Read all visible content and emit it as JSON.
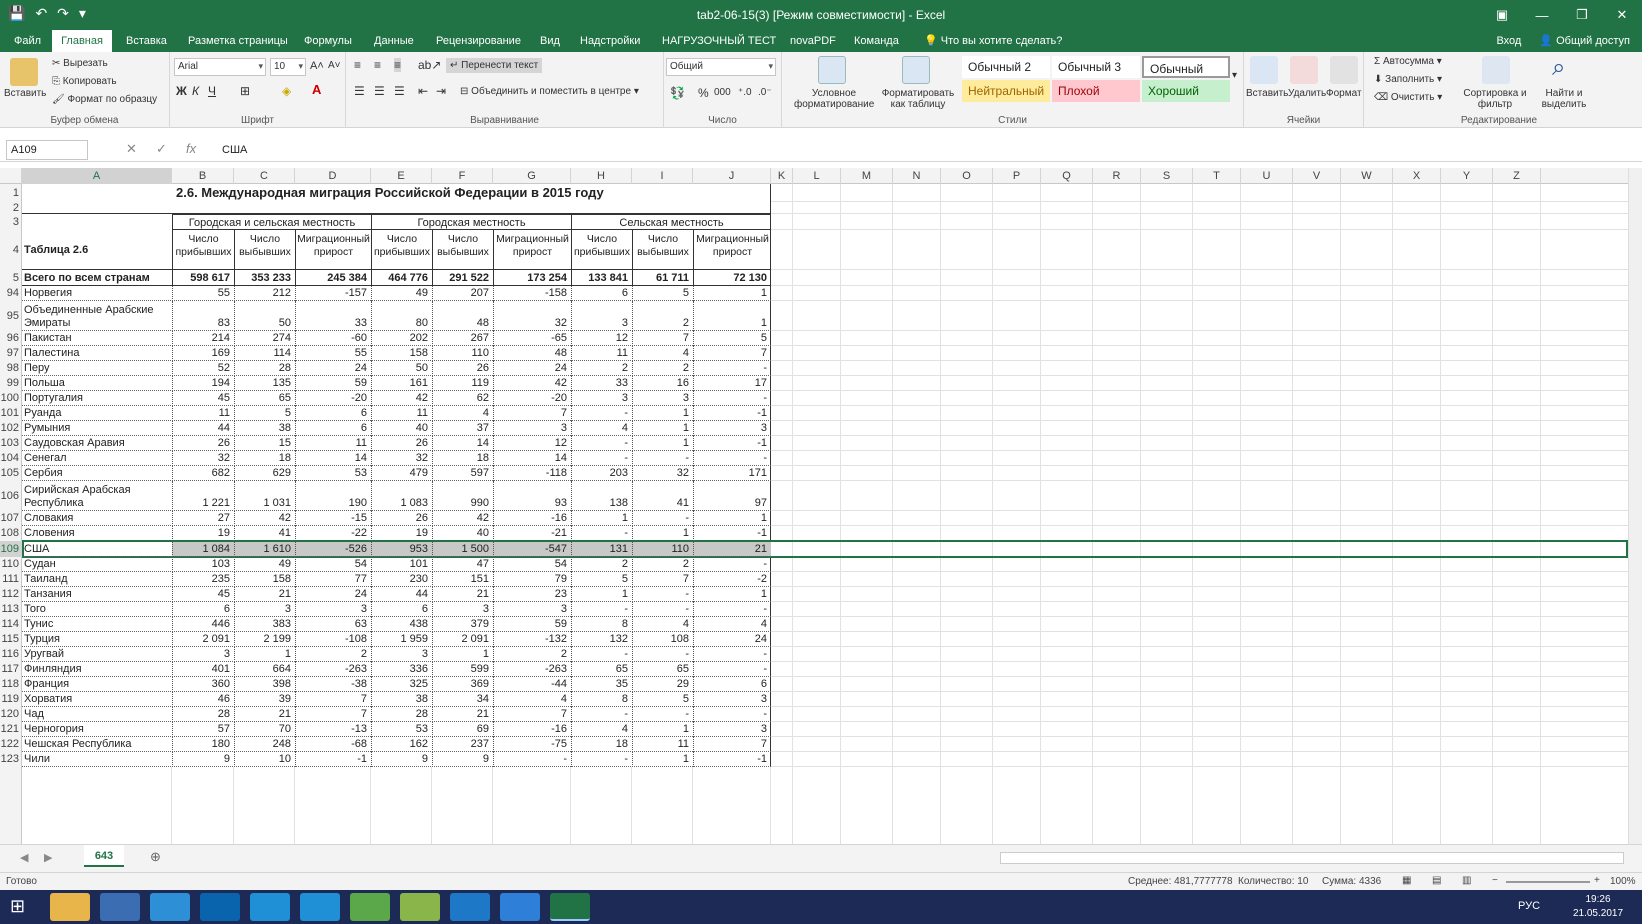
{
  "window": {
    "title": "tab2-06-15(3)  [Режим совместимости] - Excel",
    "qat": [
      "💾",
      "↶",
      "↷",
      "▾"
    ],
    "controls": [
      "▣",
      "—",
      "❐",
      "✕"
    ]
  },
  "tabs": [
    "Файл",
    "Главная",
    "Вставка",
    "Разметка страницы",
    "Формулы",
    "Данные",
    "Рецензирование",
    "Вид",
    "Надстройки",
    "НАГРУЗОЧНЫЙ ТЕСТ",
    "novaPDF",
    "Команда"
  ],
  "tell_me": "Что вы хотите сделать?",
  "account": {
    "login": "Вход",
    "share": "Общий доступ"
  },
  "ribbon": {
    "clipboard": {
      "label": "Буфер обмена",
      "paste": "Вставить",
      "cut": "Вырезать",
      "copy": "Копировать",
      "format_painter": "Формат по образцу"
    },
    "font": {
      "label": "Шрифт",
      "name": "Arial",
      "size": "10",
      "bold": "Ж",
      "italic": "К",
      "underline": "Ч"
    },
    "alignment": {
      "label": "Выравнивание",
      "wrap": "Перенести текст",
      "merge": "Объединить и поместить в центре"
    },
    "number": {
      "label": "Число",
      "format": "Общий",
      "percent": "%",
      "thousands": "000"
    },
    "styles": {
      "label": "Стили",
      "conditional": "Условное форматирование",
      "as_table": "Форматировать как таблицу",
      "items": [
        "Обычный 2",
        "Обычный 3",
        "Обычный",
        "Нейтральный",
        "Плохой",
        "Хороший"
      ],
      "colors": {
        "neutral": "#ffeb9c",
        "bad": "#ffc7ce",
        "good": "#c6efce"
      }
    },
    "cells": {
      "label": "Ячейки",
      "insert": "Вставить",
      "delete": "Удалить",
      "format": "Формат"
    },
    "editing": {
      "label": "Редактирование",
      "autosum": "Автосумма",
      "fill": "Заполнить",
      "clear": "Очистить",
      "sort": "Сортировка и фильтр",
      "find": "Найти и выделить"
    }
  },
  "formula_bar": {
    "name_box": "A109",
    "value": "США"
  },
  "columns": [
    "A",
    "B",
    "C",
    "D",
    "E",
    "F",
    "G",
    "H",
    "I",
    "J",
    "K",
    "L",
    "M",
    "N",
    "O",
    "P",
    "Q",
    "R",
    "S",
    "T",
    "U",
    "V",
    "W",
    "X",
    "Y",
    "Z"
  ],
  "sheet": {
    "title": "2.6. Международная миграция Российской Федерации в 2015 году",
    "table_label": "Таблица 2.6",
    "groups": [
      "Городская и сельская местность",
      "Городская местность",
      "Сельская местность"
    ],
    "subheaders": [
      "Число прибывших",
      "Число выбывших",
      "Миграционный прирост"
    ],
    "total": {
      "name": "Всего по всем странам",
      "values": [
        "598 617",
        "353 233",
        "245 384",
        "464 776",
        "291 522",
        "173 254",
        "133 841",
        "61 711",
        "72 130"
      ]
    },
    "header_rows": [
      "1",
      "2",
      "3",
      "4",
      "5"
    ],
    "rows": [
      {
        "n": "94",
        "name": "Норвегия",
        "v": [
          "55",
          "212",
          "-157",
          "49",
          "207",
          "-158",
          "6",
          "5",
          "1"
        ]
      },
      {
        "n": "95",
        "name": "Объединенные Арабские Эмираты",
        "v": [
          "83",
          "50",
          "33",
          "80",
          "48",
          "32",
          "3",
          "2",
          "1"
        ]
      },
      {
        "n": "96",
        "name": "Пакистан",
        "v": [
          "214",
          "274",
          "-60",
          "202",
          "267",
          "-65",
          "12",
          "7",
          "5"
        ]
      },
      {
        "n": "97",
        "name": "Палестина",
        "v": [
          "169",
          "114",
          "55",
          "158",
          "110",
          "48",
          "11",
          "4",
          "7"
        ]
      },
      {
        "n": "98",
        "name": "Перу",
        "v": [
          "52",
          "28",
          "24",
          "50",
          "26",
          "24",
          "2",
          "2",
          "-"
        ]
      },
      {
        "n": "99",
        "name": "Польша",
        "v": [
          "194",
          "135",
          "59",
          "161",
          "119",
          "42",
          "33",
          "16",
          "17"
        ]
      },
      {
        "n": "100",
        "name": "Португалия",
        "v": [
          "45",
          "65",
          "-20",
          "42",
          "62",
          "-20",
          "3",
          "3",
          "-"
        ]
      },
      {
        "n": "101",
        "name": "Руанда",
        "v": [
          "11",
          "5",
          "6",
          "11",
          "4",
          "7",
          "-",
          "1",
          "-1"
        ]
      },
      {
        "n": "102",
        "name": "Румыния",
        "v": [
          "44",
          "38",
          "6",
          "40",
          "37",
          "3",
          "4",
          "1",
          "3"
        ]
      },
      {
        "n": "103",
        "name": "Саудовская Аравия",
        "v": [
          "26",
          "15",
          "11",
          "26",
          "14",
          "12",
          "-",
          "1",
          "-1"
        ]
      },
      {
        "n": "104",
        "name": "Сенегал",
        "v": [
          "32",
          "18",
          "14",
          "32",
          "18",
          "14",
          "-",
          "-",
          "-"
        ]
      },
      {
        "n": "105",
        "name": "Сербия",
        "v": [
          "682",
          "629",
          "53",
          "479",
          "597",
          "-118",
          "203",
          "32",
          "171"
        ]
      },
      {
        "n": "106",
        "name": "Сирийская Арабская Республика",
        "v": [
          "1 221",
          "1 031",
          "190",
          "1 083",
          "990",
          "93",
          "138",
          "41",
          "97"
        ]
      },
      {
        "n": "107",
        "name": "Словакия",
        "v": [
          "27",
          "42",
          "-15",
          "26",
          "42",
          "-16",
          "1",
          "-",
          "1"
        ]
      },
      {
        "n": "108",
        "name": "Словения",
        "v": [
          "19",
          "41",
          "-22",
          "19",
          "40",
          "-21",
          "-",
          "1",
          "-1"
        ]
      },
      {
        "n": "109",
        "name": "США",
        "v": [
          "1 084",
          "1 610",
          "-526",
          "953",
          "1 500",
          "-547",
          "131",
          "110",
          "21"
        ]
      },
      {
        "n": "110",
        "name": "Судан",
        "v": [
          "103",
          "49",
          "54",
          "101",
          "47",
          "54",
          "2",
          "2",
          "-"
        ]
      },
      {
        "n": "111",
        "name": "Таиланд",
        "v": [
          "235",
          "158",
          "77",
          "230",
          "151",
          "79",
          "5",
          "7",
          "-2"
        ]
      },
      {
        "n": "112",
        "name": "Танзания",
        "v": [
          "45",
          "21",
          "24",
          "44",
          "21",
          "23",
          "1",
          "-",
          "1"
        ]
      },
      {
        "n": "113",
        "name": "Того",
        "v": [
          "6",
          "3",
          "3",
          "6",
          "3",
          "3",
          "-",
          "-",
          "-"
        ]
      },
      {
        "n": "114",
        "name": "Тунис",
        "v": [
          "446",
          "383",
          "63",
          "438",
          "379",
          "59",
          "8",
          "4",
          "4"
        ]
      },
      {
        "n": "115",
        "name": "Турция",
        "v": [
          "2 091",
          "2 199",
          "-108",
          "1 959",
          "2 091",
          "-132",
          "132",
          "108",
          "24"
        ]
      },
      {
        "n": "116",
        "name": "Уругвай",
        "v": [
          "3",
          "1",
          "2",
          "3",
          "1",
          "2",
          "-",
          "-",
          "-"
        ]
      },
      {
        "n": "117",
        "name": "Финляндия",
        "v": [
          "401",
          "664",
          "-263",
          "336",
          "599",
          "-263",
          "65",
          "65",
          "-"
        ]
      },
      {
        "n": "118",
        "name": "Франция",
        "v": [
          "360",
          "398",
          "-38",
          "325",
          "369",
          "-44",
          "35",
          "29",
          "6"
        ]
      },
      {
        "n": "119",
        "name": "Хорватия",
        "v": [
          "46",
          "39",
          "7",
          "38",
          "34",
          "4",
          "8",
          "5",
          "3"
        ]
      },
      {
        "n": "120",
        "name": "Чад",
        "v": [
          "28",
          "21",
          "7",
          "28",
          "21",
          "7",
          "-",
          "-",
          "-"
        ]
      },
      {
        "n": "121",
        "name": "Черногория",
        "v": [
          "57",
          "70",
          "-13",
          "53",
          "69",
          "-16",
          "4",
          "1",
          "3"
        ]
      },
      {
        "n": "122",
        "name": "Чешская Республика",
        "v": [
          "180",
          "248",
          "-68",
          "162",
          "237",
          "-75",
          "18",
          "11",
          "7"
        ]
      },
      {
        "n": "123",
        "name": "Чили",
        "v": [
          "9",
          "10",
          "-1",
          "9",
          "9",
          "-",
          "-",
          "1",
          "-1"
        ]
      }
    ]
  },
  "sheet_tab": "643",
  "status": {
    "ready": "Готово",
    "average": "Среднее: 481,7777778",
    "count": "Количество: 10",
    "sum": "Сумма: 4336",
    "zoom": "100%"
  },
  "taskbar": {
    "lang": "РУС",
    "time": "19:26",
    "date": "21.05.2017"
  }
}
